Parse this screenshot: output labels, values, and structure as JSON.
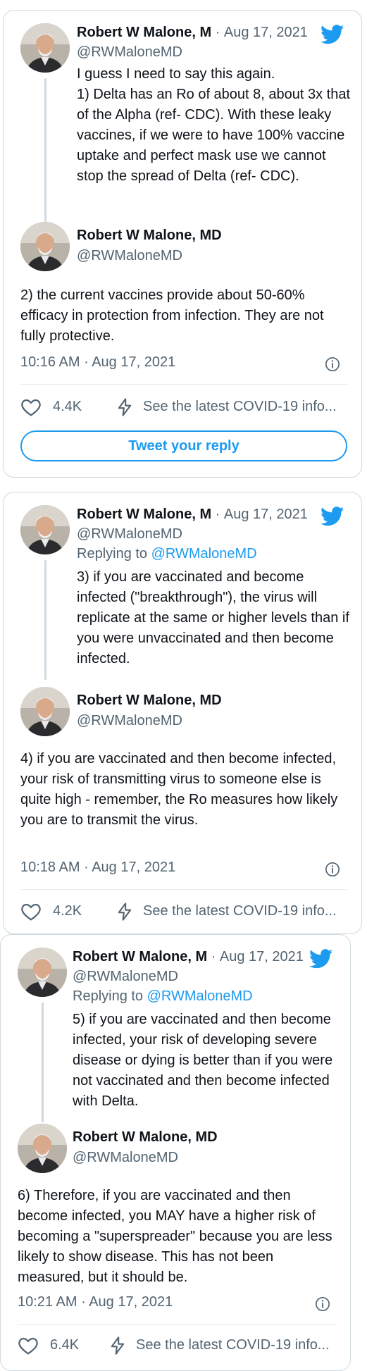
{
  "icons": {
    "bird": "twitter-bird-icon",
    "info": "info-circle-icon",
    "heart": "heart-icon",
    "bolt": "lightning-bolt-icon"
  },
  "colors": {
    "twitter_blue": "#1d9bf0",
    "secondary_text": "#536471",
    "border": "#cfd9de"
  },
  "cards": [
    {
      "first": {
        "name": "Robert W Malone, M",
        "date_sep": "·",
        "date": "Aug 17, 2021",
        "handle": "@RWMaloneMD",
        "replying_prefix": "",
        "replying_to": "",
        "text": "I guess I need to say this again.\n1) Delta has an Ro of about 8, about 3x that of the Alpha (ref- CDC).  With these leaky vaccines, if we were to have 100% vaccine uptake and perfect mask use we cannot stop the spread of Delta (ref- CDC)."
      },
      "main": {
        "name": "Robert W Malone, MD",
        "handle": "@RWMaloneMD",
        "text": "2) the current vaccines provide about 50-60% efficacy in protection from infection.  They are not fully protective.",
        "time": "10:16 AM",
        "date": "Aug 17, 2021",
        "likes": "4.4K",
        "covid_label": "See the latest COVID-19 info...",
        "reply_label": "Tweet your reply"
      }
    },
    {
      "first": {
        "name": "Robert W Malone, M",
        "date_sep": "·",
        "date": "Aug 17, 2021",
        "handle": "@RWMaloneMD",
        "replying_prefix": "Replying to ",
        "replying_to": "@RWMaloneMD",
        "text": "3) if you are vaccinated and become infected (\"breakthrough\"), the virus will replicate at the same or higher levels than if you were unvaccinated and then become infected."
      },
      "main": {
        "name": "Robert W Malone, MD",
        "handle": "@RWMaloneMD",
        "text": "4) if you are vaccinated and then become infected, your risk of transmitting virus to someone else is quite high - remember, the Ro measures how likely you are to transmit the virus.",
        "time": "10:18 AM",
        "date": "Aug 17, 2021",
        "likes": "4.2K",
        "covid_label": "See the latest COVID-19 info..."
      }
    },
    {
      "first": {
        "name": "Robert W Malone, M",
        "date_sep": "·",
        "date": "Aug 17, 2021",
        "handle": "@RWMaloneMD",
        "replying_prefix": "Replying to ",
        "replying_to": "@RWMaloneMD",
        "text": "5) if you are vaccinated and then become infected, your risk of developing severe disease or dying is better than if you were not vaccinated and then become infected with Delta."
      },
      "main": {
        "name": "Robert W Malone, MD",
        "handle": "@RWMaloneMD",
        "text": "6) Therefore, if you are vaccinated and then become infected, you MAY have a higher risk of becoming a \"superspreader\" because you are less likely to show disease.  This has not been measured, but it should be.",
        "time": "10:21 AM",
        "date": "Aug 17, 2021",
        "likes": "6.4K",
        "covid_label": "See the latest COVID-19 info..."
      }
    }
  ],
  "separator": "·"
}
